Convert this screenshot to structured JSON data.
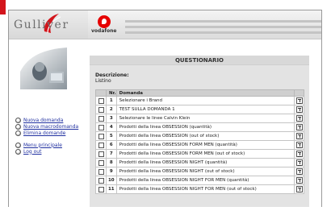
{
  "brand": {
    "logo_text": "Gulliver",
    "vodafone": "vodafone"
  },
  "content": {
    "title": "QUESTIONARIO",
    "desc_label": "Descrizione:",
    "desc_value": "Listino"
  },
  "sidebar": {
    "items": [
      {
        "label": "Nuova domanda"
      },
      {
        "label": "Nuova macrodomanda"
      },
      {
        "label": "Elimina domande"
      },
      {
        "label": "Menu principale"
      },
      {
        "label": "Log out"
      }
    ]
  },
  "table": {
    "headers": [
      "",
      "Nr.",
      "Domanda",
      ""
    ],
    "rows": [
      {
        "nr": "1",
        "domanda": "Selezionare i Brand"
      },
      {
        "nr": "2",
        "domanda": "TEST SULLA DOMANDA 1"
      },
      {
        "nr": "3",
        "domanda": "Selezionare le linee Calvin Klein"
      },
      {
        "nr": "4",
        "domanda": "Prodotti della linea OBSESSION (quantità)"
      },
      {
        "nr": "5",
        "domanda": "Prodotti della linea OBSESSION (out of stock)"
      },
      {
        "nr": "6",
        "domanda": "Prodotti della linea OBSESSION FORM MEN (quantità)"
      },
      {
        "nr": "7",
        "domanda": "Prodotti della linea OBSESSION FORM MEN (out of stock)"
      },
      {
        "nr": "8",
        "domanda": "Prodotti della linea OBSESSION NIGHT (quantità)"
      },
      {
        "nr": "9",
        "domanda": "Prodotti della linea OBSESSION NIGHT (out of stock)"
      },
      {
        "nr": "10",
        "domanda": "Prodotti della linea OBSESSION NIGHT FOR MEN (quantità)"
      },
      {
        "nr": "11",
        "domanda": "Prodotti della linea OBSESSION NIGHT FOR MEN (out of stock)"
      }
    ]
  },
  "colors": {
    "accent_red": "#d3151c",
    "link": "#2030a0",
    "panel": "#e3e3e3"
  }
}
